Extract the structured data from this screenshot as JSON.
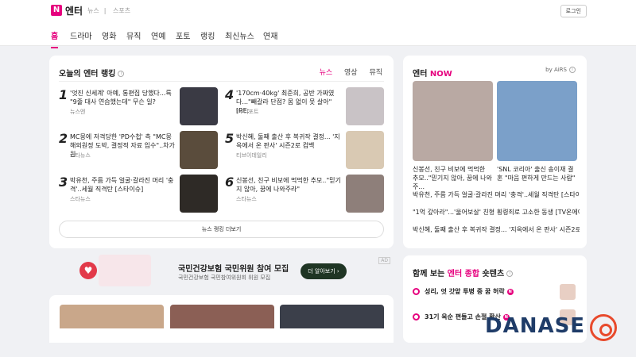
{
  "header": {
    "logo_letter": "N",
    "brand": "엔터",
    "subnav": [
      "뉴스",
      "스포츠"
    ],
    "login_label": "로그인"
  },
  "tabs": [
    "홈",
    "드라마",
    "영화",
    "뮤직",
    "연예",
    "포토",
    "랭킹",
    "최신뉴스",
    "연재"
  ],
  "ranking": {
    "title": "오늘의 엔터 랭킹",
    "info": "i",
    "filters": [
      "뉴스",
      "영상",
      "뮤직"
    ],
    "items": [
      {
        "rank": "1",
        "headline": "'엇진 신세계' 아예, 통편집 당했다...륙 \"9줄 대사 연습했는데\" 무슨 일?",
        "source": "뉴스엔",
        "thumb": "#3a3a44"
      },
      {
        "rank": "2",
        "headline": "MC몽에 저격당한 'PD수첩' 측 \"MC몽 해외원정 도박, 결정적 자료 입수\"..차가원",
        "source": "스타뉴스",
        "thumb": "#5a4c3c"
      },
      {
        "rank": "3",
        "headline": "박유천, 주름 가득 얼굴·갈라진 머리 '충격'..세월 직격탄 [스타이슈]",
        "source": "스타뉴스",
        "thumb": "#2e2a26"
      },
      {
        "rank": "4",
        "headline": "'170cm·40kg' 최준희, 공반 가짜였다...\"빼갈라 단점? 몸 없이 못 살아\" [RE:",
        "source": "TV리포트",
        "thumb": "#c9c3c6"
      },
      {
        "rank": "5",
        "headline": "박신혜, 둘째 출산 후 복귀작 결정... '지옥에서 온 판사' 시즌2로 컴백",
        "source": "티브이데일리",
        "thumb": "#d9c9b3"
      },
      {
        "rank": "6",
        "headline": "신봉선, 친구 비보에 먹먹한 추모..\"믿기지 않아, 꿈에 나와주라\"",
        "source": "스타뉴스",
        "thumb": "#8e7f7a"
      }
    ],
    "more_label": "뉴스 랭킹 더보기"
  },
  "now": {
    "title_prefix": "엔터 ",
    "title_accent": "NOW",
    "by_label": "by AiRS",
    "cards": [
      {
        "caption": "신봉선, 친구 비보에 먹먹한 추모..\"믿기지 않아, 꿈에 나와주...",
        "color": "#b9a9a3"
      },
      {
        "caption": "'SNL 코리아' 출신 송이재 결혼 \"마음 편하게 만드는 사람\"",
        "color": "#7ba0c9"
      }
    ],
    "list": [
      "박유천, 주름 가득 얼굴·갈라진 머리 '충격'..세월 직격탄 [스타이슈]",
      "\"1억 갚아라\"...'울어보살' 친형 횡령죄로 고소한 동생 [TV온에어]",
      "박신혜, 둘째 출산 후 복귀작 결정... '지옥에서 온 판사' 시즌2로 컴"
    ]
  },
  "ad": {
    "title": "국민건강보험 국민위원 참여 모집",
    "subtitle": "국민건강보험 국민참여위원회 위원 모집",
    "button": "더 알아보기 ›",
    "badge": "AD"
  },
  "related": {
    "title_prefix": "함께 보는 ",
    "title_accent": "엔터 종합",
    "title_suffix": " 숏텐츠",
    "items": [
      "성리, 엇 갓앞 투병 중 꿈 허락",
      "31기 옥순 편들고 손절 확산"
    ],
    "badge": "N"
  },
  "bottom_thumbs": [
    "#c9a78a",
    "#8b5f55",
    "#3b3f4a"
  ],
  "watermark": "DANASE",
  "colors": {
    "accent": "#e6007e",
    "watermark": "#1f3c68",
    "target": "#e84a2c"
  }
}
